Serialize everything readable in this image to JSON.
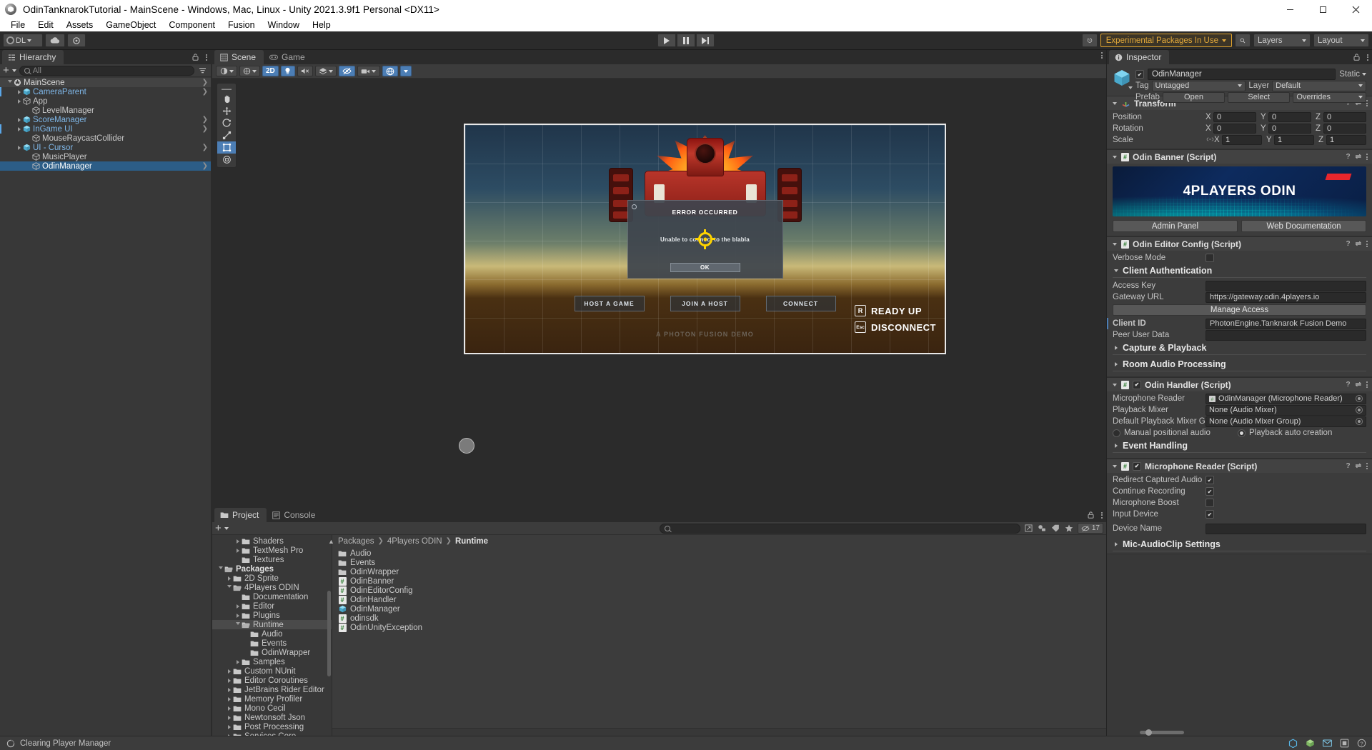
{
  "window": {
    "title": "OdinTanknarokTutorial - MainScene - Windows, Mac, Linux - Unity 2021.3.9f1 Personal <DX11>",
    "minimize": "–",
    "maximize": "□",
    "close": "✕"
  },
  "menubar": {
    "items": [
      "File",
      "Edit",
      "Assets",
      "GameObject",
      "Component",
      "Fusion",
      "Window",
      "Help"
    ]
  },
  "toolbar": {
    "account_label": "DL",
    "cloud_icon": "cloud-icon",
    "collab_icon": "collab-icon",
    "play_icon": "play-icon",
    "pause_icon": "pause-icon",
    "step_icon": "step-icon",
    "history_icon": "history-icon",
    "experimental_packages": "Experimental Packages In Use",
    "search_icon": "search-icon",
    "layers_label": "Layers",
    "layout_label": "Layout"
  },
  "hierarchy": {
    "tab_label": "Hierarchy",
    "search_placeholder": "All",
    "items": [
      {
        "label": "MainScene",
        "depth": 0,
        "type": "scene",
        "expanded": true,
        "selected": false,
        "more": true
      },
      {
        "label": "CameraParent",
        "depth": 1,
        "type": "prefab",
        "expanded": false,
        "selected": false,
        "override": true,
        "more": true
      },
      {
        "label": "App",
        "depth": 1,
        "type": "gameobject",
        "expanded": false,
        "selected": false
      },
      {
        "label": "LevelManager",
        "depth": 2,
        "type": "gameobject",
        "expanded": null,
        "selected": false
      },
      {
        "label": "ScoreManager",
        "depth": 1,
        "type": "prefab",
        "expanded": false,
        "selected": false,
        "more": true
      },
      {
        "label": "InGame UI",
        "depth": 1,
        "type": "prefab",
        "expanded": false,
        "selected": false,
        "override": true,
        "more": true
      },
      {
        "label": "MouseRaycastCollider",
        "depth": 2,
        "type": "gameobject",
        "expanded": null,
        "selected": false
      },
      {
        "label": "UI - Cursor",
        "depth": 1,
        "type": "prefab",
        "expanded": false,
        "selected": false,
        "more": true
      },
      {
        "label": "MusicPlayer",
        "depth": 2,
        "type": "gameobject",
        "expanded": null,
        "selected": false
      },
      {
        "label": "OdinManager",
        "depth": 2,
        "type": "gameobject",
        "expanded": null,
        "selected": true,
        "more": true
      }
    ]
  },
  "scene": {
    "tabs": [
      {
        "label": "Scene",
        "icon": "scene-icon",
        "active": true
      },
      {
        "label": "Game",
        "icon": "game-icon",
        "active": false
      }
    ],
    "tools": [
      "hand-tool",
      "move-tool",
      "rotate-tool",
      "scale-tool",
      "rect-tool",
      "transform-tool"
    ],
    "toolbar_buttons": [
      "shading-mode",
      "2D",
      "lighting",
      "audio",
      "fx",
      "visibility",
      "camera",
      "gizmos"
    ],
    "mode_2d": "2D"
  },
  "game_overlay": {
    "error_title": "ERROR OCCURRED",
    "error_message": "Unable to connect to the blabla",
    "ok_button": "OK",
    "menu_buttons": [
      "HOST A GAME",
      "JOIN A HOST",
      "CONNECT"
    ],
    "demo_label": "A PHOTON FUSION DEMO",
    "hud": [
      {
        "key": "R",
        "label": "READY UP"
      },
      {
        "key": "Esc",
        "label": "DISCONNECT"
      }
    ]
  },
  "project": {
    "tabs": [
      {
        "label": "Project",
        "icon": "folder-icon",
        "active": true
      },
      {
        "label": "Console",
        "icon": "console-icon",
        "active": false
      }
    ],
    "search_placeholder": "",
    "filter_count": "17",
    "breadcrumb": [
      "Packages",
      "4Players ODIN",
      "Runtime"
    ],
    "tree": [
      {
        "label": "Shaders",
        "depth": 2,
        "expanded": false
      },
      {
        "label": "TextMesh Pro",
        "depth": 2,
        "expanded": false
      },
      {
        "label": "Textures",
        "depth": 2,
        "expanded": null
      },
      {
        "label": "Packages",
        "depth": 0,
        "expanded": true,
        "bold": true
      },
      {
        "label": "2D Sprite",
        "depth": 1,
        "expanded": false
      },
      {
        "label": "4Players ODIN",
        "depth": 1,
        "expanded": true
      },
      {
        "label": "Documentation",
        "depth": 2,
        "expanded": null
      },
      {
        "label": "Editor",
        "depth": 2,
        "expanded": false
      },
      {
        "label": "Plugins",
        "depth": 2,
        "expanded": false
      },
      {
        "label": "Runtime",
        "depth": 2,
        "expanded": true,
        "selected": true
      },
      {
        "label": "Audio",
        "depth": 3,
        "expanded": null
      },
      {
        "label": "Events",
        "depth": 3,
        "expanded": null
      },
      {
        "label": "OdinWrapper",
        "depth": 3,
        "expanded": null
      },
      {
        "label": "Samples",
        "depth": 2,
        "expanded": false
      },
      {
        "label": "Custom NUnit",
        "depth": 1,
        "expanded": false
      },
      {
        "label": "Editor Coroutines",
        "depth": 1,
        "expanded": false
      },
      {
        "label": "JetBrains Rider Editor",
        "depth": 1,
        "expanded": false
      },
      {
        "label": "Memory Profiler",
        "depth": 1,
        "expanded": false
      },
      {
        "label": "Mono Cecil",
        "depth": 1,
        "expanded": false
      },
      {
        "label": "Newtonsoft Json",
        "depth": 1,
        "expanded": false
      },
      {
        "label": "Post Processing",
        "depth": 1,
        "expanded": false
      },
      {
        "label": "Services Core",
        "depth": 1,
        "expanded": false
      }
    ],
    "assets": [
      {
        "label": "Audio",
        "type": "folder"
      },
      {
        "label": "Events",
        "type": "folder"
      },
      {
        "label": "OdinWrapper",
        "type": "folder"
      },
      {
        "label": "OdinBanner",
        "type": "script"
      },
      {
        "label": "OdinEditorConfig",
        "type": "script"
      },
      {
        "label": "OdinHandler",
        "type": "script"
      },
      {
        "label": "OdinManager",
        "type": "prefab"
      },
      {
        "label": "odinsdk",
        "type": "script"
      },
      {
        "label": "OdinUnityException",
        "type": "script"
      }
    ]
  },
  "inspector": {
    "tab_label": "Inspector",
    "object_name": "OdinManager",
    "enabled": true,
    "static_label": "Static",
    "tag_label": "Tag",
    "tag_value": "Untagged",
    "layer_label": "Layer",
    "layer_value": "Default",
    "prefab_label": "Prefab",
    "prefab_open": "Open",
    "prefab_select": "Select",
    "prefab_overrides": "Overrides",
    "transform": {
      "title": "Transform",
      "position_label": "Position",
      "rotation_label": "Rotation",
      "scale_label": "Scale",
      "position": {
        "x": "0",
        "y": "0",
        "z": "0"
      },
      "rotation": {
        "x": "0",
        "y": "0",
        "z": "0"
      },
      "scale": {
        "x": "1",
        "y": "1",
        "z": "1"
      },
      "axes": [
        "X",
        "Y",
        "Z"
      ]
    },
    "odin_banner": {
      "title": "Odin Banner (Script)",
      "banner_text": "4PLAYERS ODIN",
      "admin_panel": "Admin Panel",
      "web_documentation": "Web Documentation"
    },
    "odin_editor_config": {
      "title": "Odin Editor Config (Script)",
      "verbose_mode_label": "Verbose Mode",
      "verbose_mode": false,
      "client_auth_header": "Client Authentication",
      "access_key_label": "Access Key",
      "access_key_value": "",
      "gateway_url_label": "Gateway URL",
      "gateway_url_value": "https://gateway.odin.4players.io",
      "manage_access": "Manage Access",
      "client_id_label": "Client ID",
      "client_id_value": "PhotonEngine.Tanknarok Fusion Demo",
      "peer_user_data_label": "Peer User Data",
      "peer_user_data_value": "",
      "capture_playback_header": "Capture & Playback",
      "room_audio_header": "Room Audio Processing"
    },
    "odin_handler": {
      "title": "Odin Handler (Script)",
      "enabled": true,
      "microphone_reader_label": "Microphone Reader",
      "microphone_reader_value": "OdinManager (Microphone Reader)",
      "playback_mixer_label": "Playback Mixer",
      "playback_mixer_value": "None (Audio Mixer)",
      "default_playback_group_label": "Default Playback Mixer Group",
      "default_playback_group_value": "None (Audio Mixer Group)",
      "manual_positional_audio": "Manual positional audio",
      "playback_auto_creation": "Playback auto creation",
      "audio_mode": "playback_auto_creation",
      "event_handling_header": "Event Handling"
    },
    "microphone_reader": {
      "title": "Microphone Reader (Script)",
      "enabled": true,
      "rows": [
        {
          "label": "Redirect Captured Audio",
          "checked": true
        },
        {
          "label": "Continue Recording",
          "checked": true
        },
        {
          "label": "Microphone Boost",
          "checked": false
        },
        {
          "label": "Input Device",
          "checked": true
        }
      ],
      "device_name_label": "Device Name",
      "device_name_value": "",
      "mic_audioclip_header": "Mic-AudioClip Settings"
    }
  },
  "statusbar": {
    "message": "Clearing Player Manager",
    "icons": [
      "unity-icon",
      "package-icon",
      "mail-icon",
      "layers-icon",
      "help-icon"
    ]
  },
  "colors": {
    "accent_blue": "#4c7eb5",
    "selection_blue": "#2c5d87",
    "experimental_orange": "#e3a93a",
    "panel_bg": "#383838",
    "panel_header": "#3c3c3c"
  }
}
